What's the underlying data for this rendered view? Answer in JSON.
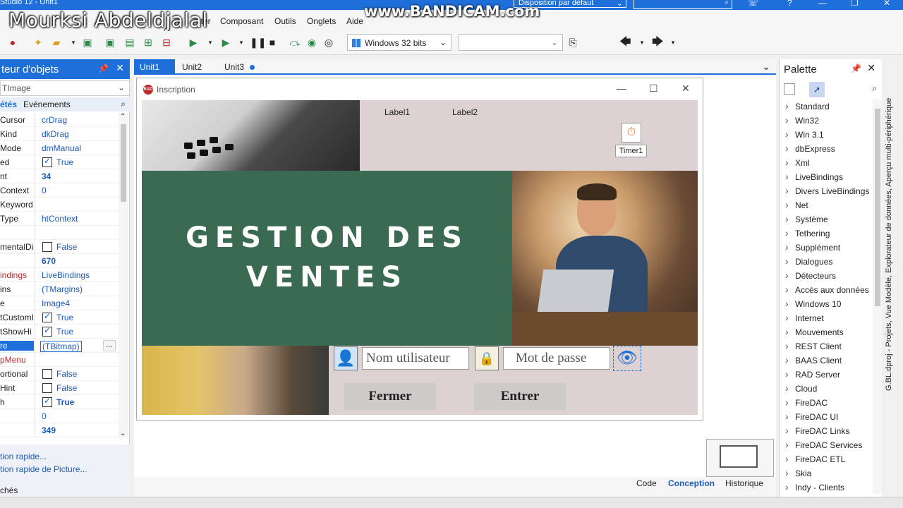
{
  "window": {
    "title": "Studio 12 - Unit1",
    "layout_combo": "Disposition par défaut"
  },
  "watermarks": {
    "name": "Mourksi Abdeldjalal",
    "recorder": "www.BANDICAM.com"
  },
  "menu": {
    "items": [
      "Composant",
      "Outils",
      "Onglets",
      "Aide"
    ],
    "partial": "iter"
  },
  "toolbar": {
    "platform": "Windows 32 bits"
  },
  "inspector": {
    "title": "teur d'objets",
    "object": "TImage",
    "tab_props": "étés",
    "tab_events": "Evénements",
    "rows": [
      {
        "name": "Cursor",
        "value": "crDrag"
      },
      {
        "name": "Kind",
        "value": "dkDrag"
      },
      {
        "name": "Mode",
        "value": "dmManual"
      },
      {
        "name": "ed",
        "check": true,
        "value": "True"
      },
      {
        "name": "nt",
        "value": "34",
        "bold": true
      },
      {
        "name": "Context",
        "value": "0"
      },
      {
        "name": "Keyword",
        "value": ""
      },
      {
        "name": "Type",
        "value": "htContext"
      },
      {
        "name": "",
        "value": ""
      },
      {
        "name": "mentalDis",
        "check": false,
        "value": "False"
      },
      {
        "name": "",
        "value": "670",
        "bold": true
      },
      {
        "name": "indings",
        "value": "LiveBindings",
        "red": true
      },
      {
        "name": "ins",
        "value": "(TMargins)"
      },
      {
        "name": "e",
        "value": "Image4"
      },
      {
        "name": "tCustomI",
        "check": true,
        "value": "True"
      },
      {
        "name": "tShowHi",
        "check": true,
        "value": "True"
      },
      {
        "name": "re",
        "value": "(TBitmap)",
        "selected": true,
        "dots": "..."
      },
      {
        "name": "pMenu",
        "value": "",
        "red": true
      },
      {
        "name": "ortional",
        "check": false,
        "value": "False"
      },
      {
        "name": "Hint",
        "check": false,
        "value": "False"
      },
      {
        "name": "h",
        "check": true,
        "value": "True",
        "bold": true
      },
      {
        "name": "",
        "value": "0"
      },
      {
        "name": "",
        "value": "349",
        "bold": true
      }
    ],
    "quick1": "tion rapide...",
    "quick2": "tion rapide de Picture...",
    "caches": "chés"
  },
  "editor": {
    "tabs": [
      "Unit1",
      "Unit2",
      "Unit3"
    ],
    "view_tabs": {
      "code": "Code",
      "design": "Conception",
      "history": "Historique"
    }
  },
  "form": {
    "title": "Inscription",
    "label1": "Label1",
    "label2": "Label2",
    "timer": "Timer1",
    "banner_line1": "GESTION DES",
    "banner_line2": "VENTES",
    "username_placeholder": "Nom utilisateur",
    "password_placeholder": "Mot de passe",
    "btn_close": "Fermer",
    "btn_enter": "Entrer"
  },
  "palette": {
    "title": "Palette",
    "items": [
      "Standard",
      "Win32",
      "Win 3.1",
      "dbExpress",
      "Xml",
      "LiveBindings",
      "Divers LiveBindings",
      "Net",
      "Système",
      "Tethering",
      "Supplément",
      "Dialogues",
      "Détecteurs",
      "Accès aux données",
      "Windows 10",
      "Internet",
      "Mouvements",
      "REST Client",
      "BAAS Client",
      "RAD Server",
      "Cloud",
      "FireDAC",
      "FireDAC UI",
      "FireDAC Links",
      "FireDAC Services",
      "FireDAC ETL",
      "Skia",
      "Indy - Clients"
    ]
  },
  "side_panel": "G.BL.dproj - Projets, Vue Modèle, Explorateur de données, Aperçu multi-périphérique",
  "colors": {
    "accent": "#1e6fd9",
    "banner": "#3a6b52",
    "form_bg": "#ddd2d2"
  }
}
